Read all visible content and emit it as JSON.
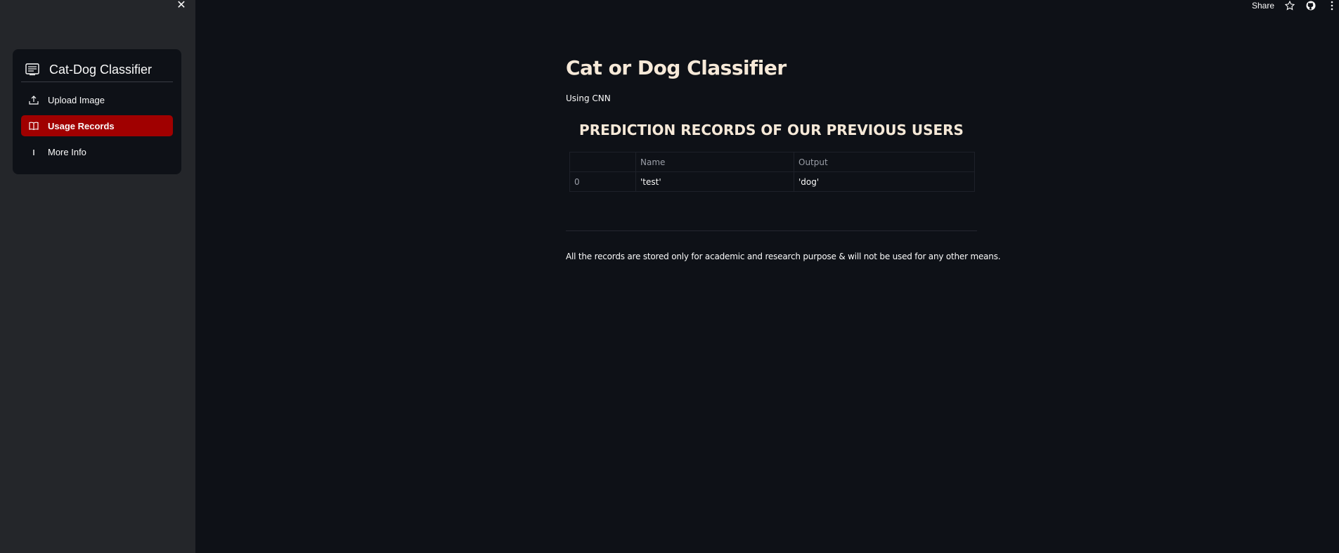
{
  "sidebar": {
    "close_glyph": "✕",
    "menu_title": "Cat-Dog Classifier",
    "items": [
      {
        "label": "Upload Image",
        "icon": "upload-icon",
        "active": false
      },
      {
        "label": "Usage Records",
        "icon": "book-icon",
        "active": true
      },
      {
        "label": "More Info",
        "icon": "info-icon",
        "active": false
      }
    ]
  },
  "toolbar": {
    "share_label": "Share"
  },
  "main": {
    "title": "Cat or Dog Classifier",
    "subtitle": "Using CNN",
    "section_title": "PREDICTION RECORDS OF OUR PREVIOUS USERS",
    "table": {
      "headers": [
        "",
        "Name",
        "Output"
      ],
      "rows": [
        [
          "0",
          "'test'",
          "'dog'"
        ]
      ]
    },
    "footnote": "All the records are stored only for academic and research purpose & will not be used for any other means."
  },
  "colors": {
    "background": "#0e1117",
    "sidebar": "#24262a",
    "active_item": "#a00000",
    "heading": "#f6e9d8"
  }
}
